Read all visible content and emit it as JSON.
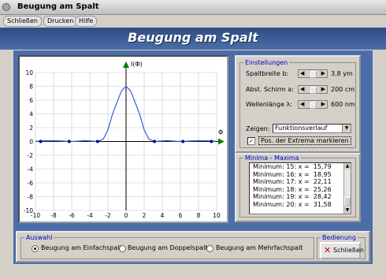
{
  "window": {
    "title": "Beugung am Spalt"
  },
  "menu": {
    "items": [
      "Schließen",
      "Drucken",
      "Hilfe"
    ]
  },
  "banner": {
    "title": "Beugung am Spalt"
  },
  "plot": {
    "y_axis_label": "I(Φ)",
    "x_axis_label": "Φ",
    "x_ticks": [
      "-10",
      "-8",
      "-6",
      "-4",
      "-2",
      "0",
      "2",
      "4",
      "6",
      "8",
      "10"
    ],
    "y_ticks": [
      "10",
      "8",
      "6",
      "4",
      "2",
      "0",
      "-2",
      "-4",
      "-6",
      "-8",
      "-10"
    ],
    "curve_color": "#3a5bd8",
    "marker_color": "#00008b",
    "axis_arrow_color": "#008000"
  },
  "chart_data": {
    "type": "line",
    "xlim": [
      -10,
      10
    ],
    "ylim": [
      -10,
      10
    ],
    "grid": true,
    "x": [
      -10,
      -9,
      -8,
      -7,
      -6.28,
      -5.5,
      -4.49,
      -3.6,
      -3.14,
      -2.5,
      -2,
      -1.5,
      -1,
      -0.5,
      0,
      0.5,
      1,
      1.5,
      2,
      2.5,
      3.14,
      3.6,
      4.49,
      5.5,
      6.28,
      7,
      8,
      9,
      10
    ],
    "y": [
      0.02,
      0.1,
      0.12,
      0.07,
      0.0,
      0.04,
      0.13,
      0.05,
      0.0,
      0.37,
      1.69,
      3.95,
      5.67,
      7.35,
      8.0,
      7.35,
      5.67,
      3.95,
      1.69,
      0.37,
      0.0,
      0.05,
      0.13,
      0.04,
      0.0,
      0.07,
      0.12,
      0.1,
      0.02
    ],
    "markers_x": [
      -9.42,
      -6.28,
      -3.14,
      3.14,
      6.28,
      9.42
    ],
    "markers_y": [
      0,
      0,
      0,
      0,
      0,
      0
    ]
  },
  "settings": {
    "legend": "Einstellungen",
    "spalt_label": "Spaltbreite b:",
    "spalt_value": "3,8 ym",
    "abst_label": "Abst. Schirm a:",
    "abst_value": "200 cm",
    "wellen_label": "Wellenlänge λ:",
    "wellen_value": "600 nm",
    "zeigen_label": "Zeigen:",
    "zeigen_value": "Funktionsverlauf",
    "checkbox_label": "Pos. der Extrema markieren",
    "checkbox_checked": true
  },
  "minmax": {
    "legend": "Minima - Maxima",
    "rows": [
      "Minimum: 15: x =  15,79",
      "Minimum: 16: x =  18,95",
      "Minimum: 17: x =  22,11",
      "Minimum: 18: x =  25,26",
      "Minimum: 19: x =  28,42",
      "Minimum: 20: x =  31,58"
    ]
  },
  "auswahl": {
    "legend": "Auswahl",
    "options": [
      "Beugung am Einfachspalt",
      "Beugung am Doppelspalt",
      "Beugung am Mehrfachspalt"
    ],
    "selected_index": 0
  },
  "bedienung": {
    "legend": "Bedienung",
    "close_label": "Schließen"
  }
}
